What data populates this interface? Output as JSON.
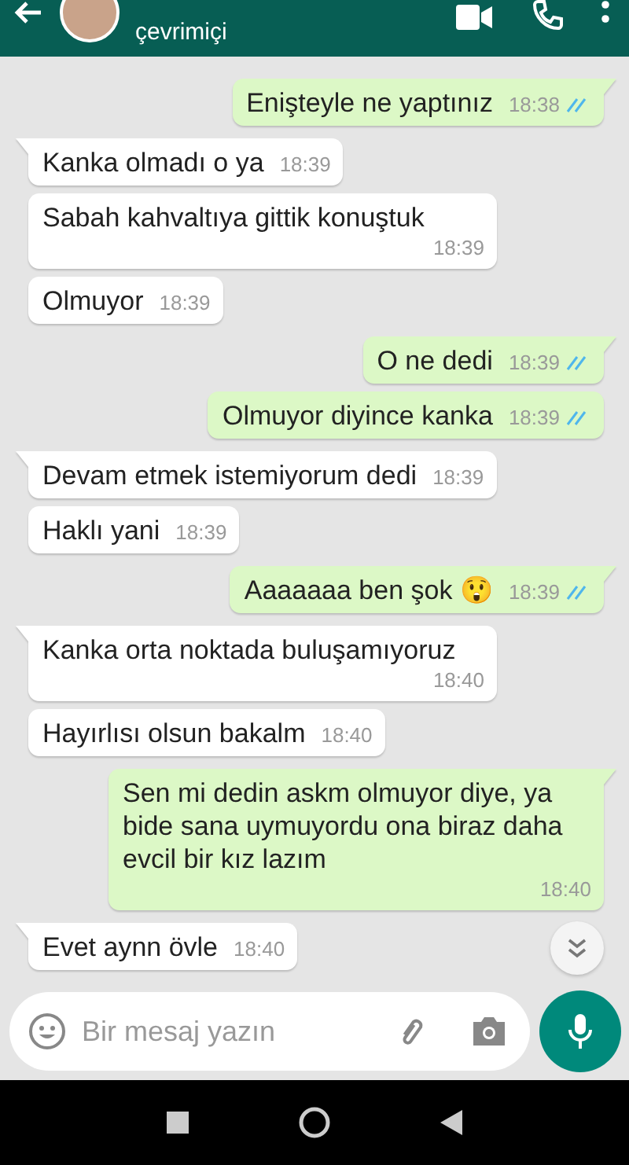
{
  "header": {
    "status": "çevrimiçi"
  },
  "messages": [
    {
      "kind": "sent",
      "text": "Enişteyle ne yaptınız",
      "time": "18:38",
      "tail": true,
      "read": true
    },
    {
      "kind": "received",
      "text": "Kanka olmadı o ya",
      "time": "18:39",
      "tail": true
    },
    {
      "kind": "received",
      "text": "Sabah kahvaltıya gittik konuştuk",
      "time": "18:39",
      "tail": false
    },
    {
      "kind": "received",
      "text": "Olmuyor",
      "time": "18:39",
      "tail": false
    },
    {
      "kind": "sent",
      "text": "O ne dedi",
      "time": "18:39",
      "tail": true,
      "read": true
    },
    {
      "kind": "sent",
      "text": "Olmuyor diyince kanka",
      "time": "18:39",
      "tail": false,
      "read": true
    },
    {
      "kind": "received",
      "text": "Devam etmek istemiyorum dedi",
      "time": "18:39",
      "tail": true
    },
    {
      "kind": "received",
      "text": "Haklı yani",
      "time": "18:39",
      "tail": false
    },
    {
      "kind": "sent",
      "text": "Aaaaaaa ben şok 😲",
      "time": "18:39",
      "tail": true,
      "read": true
    },
    {
      "kind": "received",
      "text": "Kanka orta noktada buluşamıyoruz",
      "time": "18:40",
      "tail": true
    },
    {
      "kind": "received",
      "text": "Hayırlısı olsun bakalm",
      "time": "18:40",
      "tail": false
    },
    {
      "kind": "sent",
      "text": "Sen mi dedin askm olmuyor diye, ya bide sana uymuyordu ona biraz daha evcil bir kız lazım",
      "time": "18:40",
      "tail": true
    },
    {
      "kind": "received",
      "text": "Evet aynn övle",
      "time": "18:40",
      "tail": true
    }
  ],
  "composer": {
    "placeholder": "Bir mesaj yazın"
  }
}
